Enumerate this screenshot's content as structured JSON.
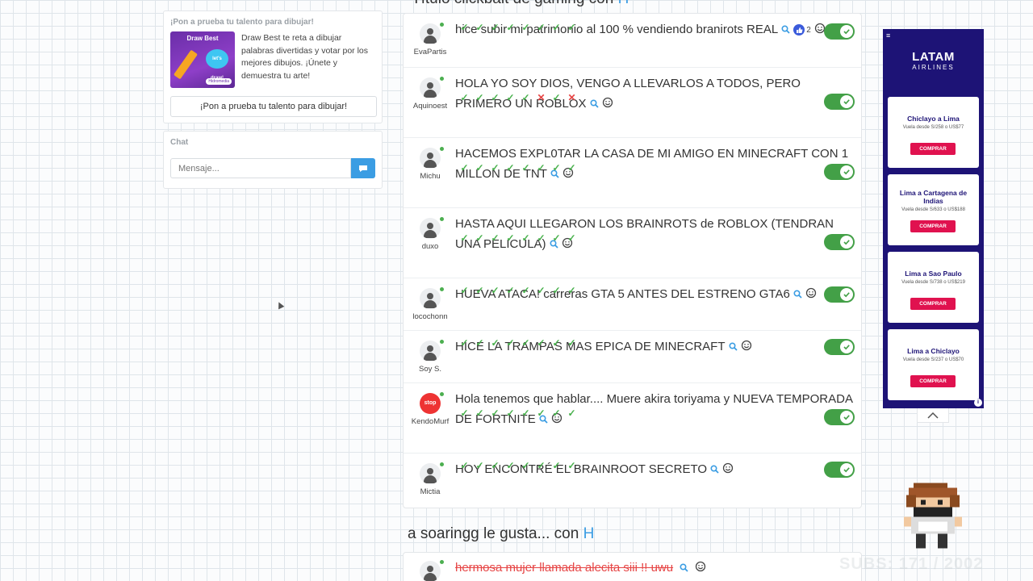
{
  "left": {
    "promo": {
      "heading": "¡Pon a prueba tu talento para dibujar!",
      "image_title": "Draw Best",
      "image_bubble": "let's draw!",
      "image_brand": "Hidromedia",
      "text": "Draw Best te reta a dibujar palabras divertidas y votar por los mejores dibujos. ¡Únete y demuestra tu arte!",
      "button": "¡Pon a prueba tu talento para dibujar!"
    },
    "chat": {
      "heading": "Chat",
      "placeholder": "Mensaje..."
    }
  },
  "feed": {
    "top_section_title": "Título clickbait de gaming con ",
    "top_section_highlight": "H",
    "items": [
      {
        "user": "EvaPartis",
        "title": "hice subir mi patrimonio al 100 % vendiendo branirots REAL",
        "likes": "2",
        "checks": [
          "ok",
          "ok",
          "ok",
          "ok",
          "ok",
          "ok",
          "ok",
          "ok"
        ]
      },
      {
        "user": "Aquinoest",
        "title": "HOLA YO SOY DIOS, VENGO A LLEVARLOS A TODOS, PERO PRIMERO UN ROBLOX",
        "checks": [
          "ok",
          "ok",
          "ok",
          "ok",
          "ok",
          "x",
          "ok",
          "x"
        ]
      },
      {
        "user": "Michu",
        "title": "HACEMOS EXPL0TAR LA CASA DE MI AMIGO EN MINECRAFT CON 1 MILLON DE TNT",
        "checks": [
          "ok",
          "ok",
          "ok",
          "ok",
          "ok",
          "ok",
          "ok",
          "ok"
        ]
      },
      {
        "user": "duxo",
        "title": "HASTA AQUI LLEGARON LOS BRAINROTS de ROBLOX (TENDRAN UNA PELICULA)",
        "checks": [
          "ok",
          "ok",
          "ok",
          "ok",
          "ok",
          "ok",
          "ok",
          "ok"
        ]
      },
      {
        "user": "locochonn",
        "title": "HUEVA ATACA! carreras GTA 5 ANTES DEL ESTRENO GTA6",
        "checks": [
          "ok",
          "ok",
          "ok",
          "ok",
          "ok",
          "ok",
          "ok",
          "ok"
        ]
      },
      {
        "user": "Soy S.",
        "title": "HICE LA TRAMPAS MAS EPICA DE MINECRAFT",
        "checks": [
          "ok",
          "ok",
          "ok",
          "ok",
          "ok",
          "ok",
          "ok",
          "ok"
        ]
      },
      {
        "user": "KendoMurf",
        "title": "Hola tenemos que hablar.... Muere akira toriyama y NUEVA TEMPORADA DE FORTNITE",
        "checks": [
          "ok",
          "ok",
          "ok",
          "ok",
          "ok",
          "ok",
          "ok",
          "ok"
        ]
      },
      {
        "user": "Mictia",
        "title": "HOY ENCONTRÉ EL BRAINROOT SECRETO",
        "checks": [
          "ok",
          "ok",
          "ok",
          "ok",
          "ok",
          "ok",
          "ok",
          "ok"
        ]
      }
    ],
    "second_section_title": "a soaringg le gusta... con ",
    "second_section_highlight": "H",
    "second_item_title": "hermosa mujer llamada alecita siii !! uwu"
  },
  "ad": {
    "menu": "≡",
    "logo_main": "LATAM",
    "logo_sub": "AIRLINES",
    "offers": [
      {
        "route": "Chiclayo a Lima",
        "price": "Vuela desde S/258 o US$77",
        "cta": "COMPRAR"
      },
      {
        "route": "Lima a Cartagena de Indias",
        "price": "Vuela desde S/633 o US$188",
        "cta": "COMPRAR"
      },
      {
        "route": "Lima a Sao Paulo",
        "price": "Vuela desde S/738 o US$219",
        "cta": "COMPRAR"
      },
      {
        "route": "Lima a Chiclayo",
        "price": "Vuela desde S/237 o US$70",
        "cta": "COMPRAR"
      }
    ],
    "info": "i"
  },
  "overlay": {
    "subs_text": "SUBS: 171 / 2002"
  },
  "colors": {
    "accent": "#3b9de3",
    "check": "#47b04b",
    "cross": "#e64545",
    "toggle_on": "#43a047",
    "ad_bg": "#1d1376",
    "ad_cta": "#e0124f"
  }
}
